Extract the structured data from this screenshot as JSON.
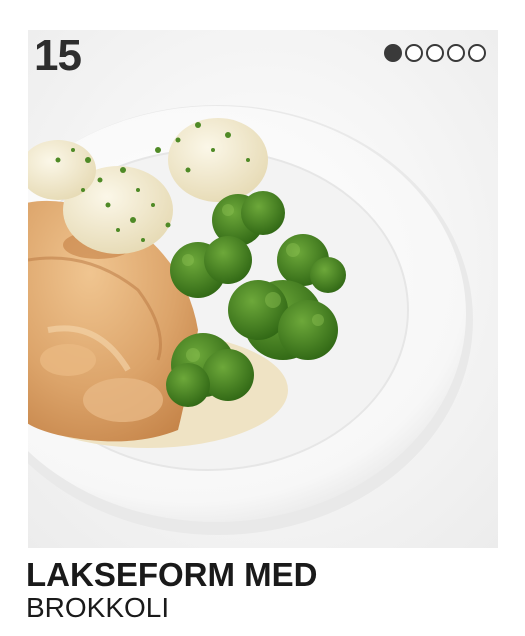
{
  "dish": {
    "number": "15",
    "title": "LAKSEFORM MED",
    "subtitle": "BROKKOLI"
  },
  "rating": {
    "filled": 1,
    "total": 5
  },
  "photo": {
    "description_icon": "food-photo",
    "accent_colors": {
      "broccoli": "#3f7d1e",
      "salmon": "#e3b07a",
      "potato": "#f2ead0",
      "plate": "#ffffff"
    }
  }
}
